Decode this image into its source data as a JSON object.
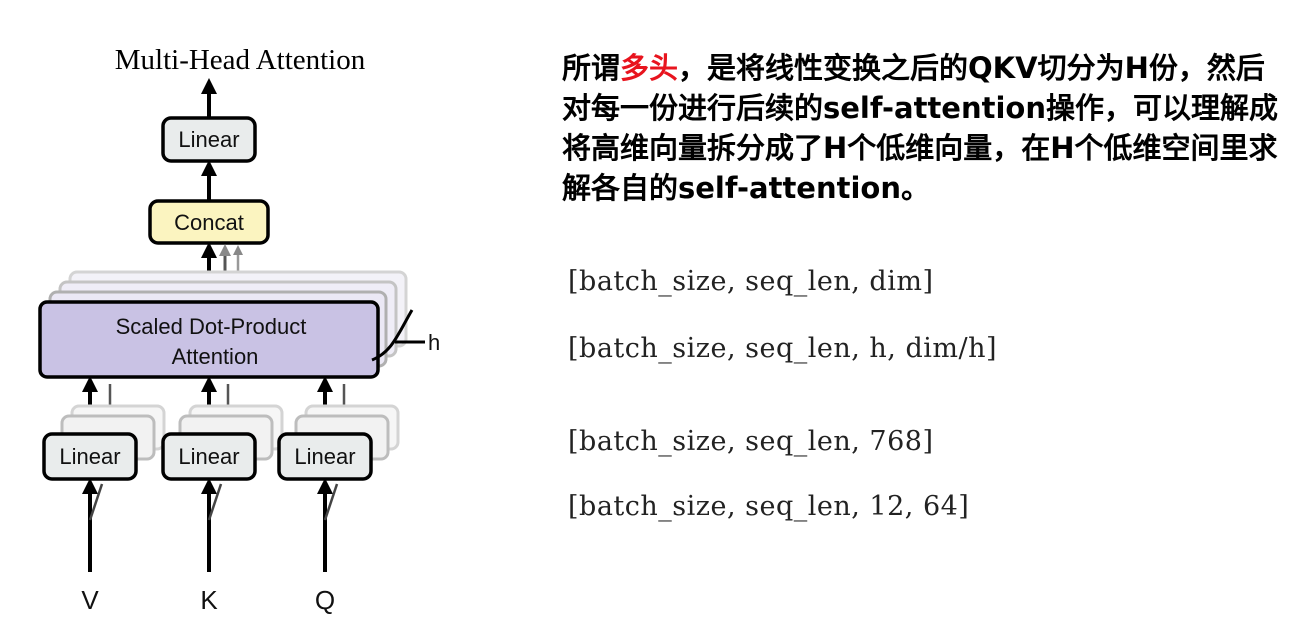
{
  "diagram": {
    "title": "Multi-Head Attention",
    "linear_top": "Linear",
    "concat": "Concat",
    "attention_line1": "Scaled Dot-Product",
    "attention_line2": "Attention",
    "h_label": "h",
    "linear_v": "Linear",
    "linear_k": "Linear",
    "linear_q": "Linear",
    "input_v": "V",
    "input_k": "K",
    "input_q": "Q",
    "colors": {
      "linear_fill": "#e9ecec",
      "concat_fill": "#fbf4c0",
      "attention_fill": "#c9c2e4",
      "stack_fill": "#efedf7"
    }
  },
  "description": {
    "prefix": "所谓",
    "highlight": "多头",
    "rest": "，是将线性变换之后的QKV切分为H份，然后对每一份进行后续的self-attention操作，可以理解成将高维向量拆分成了H个低维向量，在H个低维空间里求解各自的self-attention。"
  },
  "shapes": [
    "[batch_size, seq_len, dim]",
    "[batch_size, seq_len, h, dim/h]",
    "[batch_size, seq_len, 768]",
    "[batch_size, seq_len, 12, 64]"
  ]
}
